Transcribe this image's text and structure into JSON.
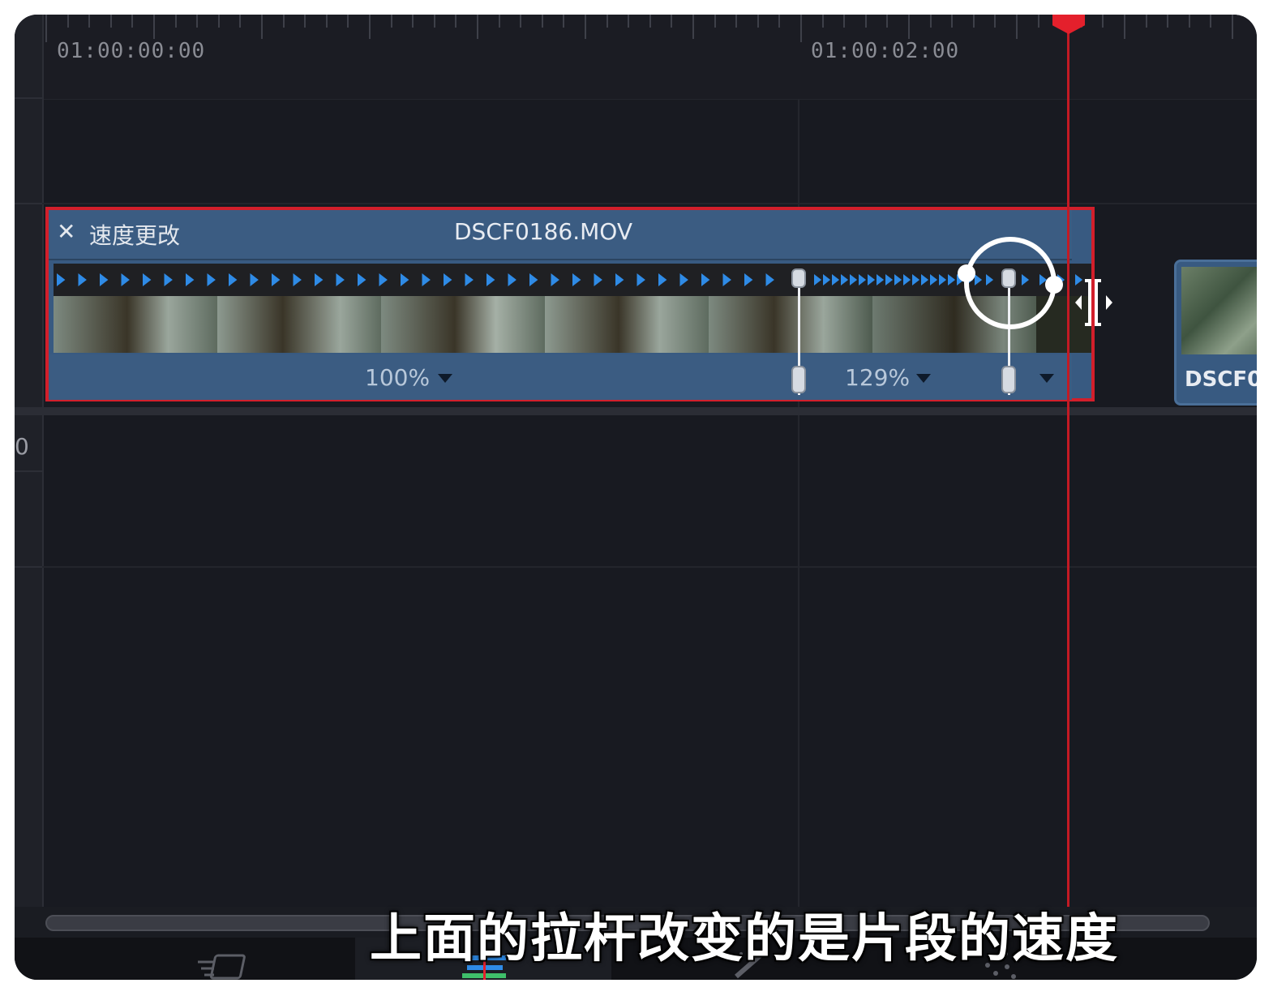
{
  "timeline": {
    "timecodes": [
      "01:00:00:00",
      "01:00:02:00"
    ],
    "row_number": "0"
  },
  "clip": {
    "speed_close_glyph": "✕",
    "speed_change_label": "速度更改",
    "name": "DSCF0186.MOV",
    "segments": [
      {
        "percent": "100%"
      },
      {
        "percent": "129%"
      }
    ]
  },
  "next_clip": {
    "name": "DSCF0"
  },
  "subtitle": "上面的拉杆改变的是片段的速度",
  "colors": {
    "playhead": "#e4202c",
    "clip_blue": "#385a81",
    "selection_red": "#d21f2b",
    "speed_arrow": "#2f8be6"
  },
  "icons": [
    "close-icon",
    "speed-caret-icon",
    "retime-handle-icon",
    "trim-edit-icon",
    "cut-tab-icon",
    "edit-tab-icon",
    "effects-tab-icon",
    "audio-tab-icon"
  ]
}
